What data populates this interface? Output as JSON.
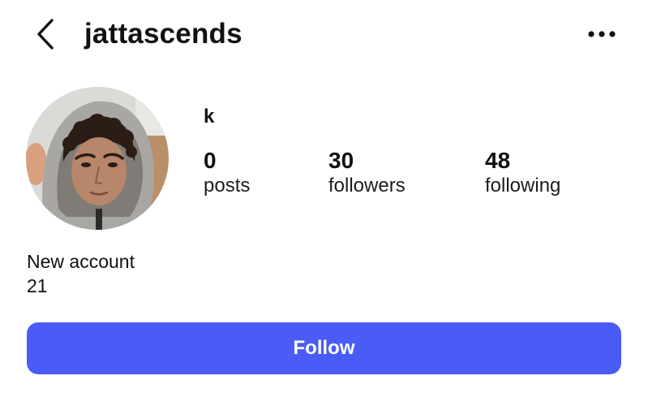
{
  "header": {
    "username": "jattascends",
    "back_icon": "chevron-left-icon",
    "more_icon": "more-horizontal-icon"
  },
  "profile": {
    "display_name": "k",
    "stats": [
      {
        "value": "0",
        "label": "posts"
      },
      {
        "value": "30",
        "label": "followers"
      },
      {
        "value": "48",
        "label": "following"
      }
    ],
    "bio_lines": [
      "New account",
      "21"
    ]
  },
  "actions": {
    "follow_label": "Follow"
  },
  "colors": {
    "accent": "#4a5cf5",
    "text": "#111111",
    "background": "#ffffff"
  }
}
